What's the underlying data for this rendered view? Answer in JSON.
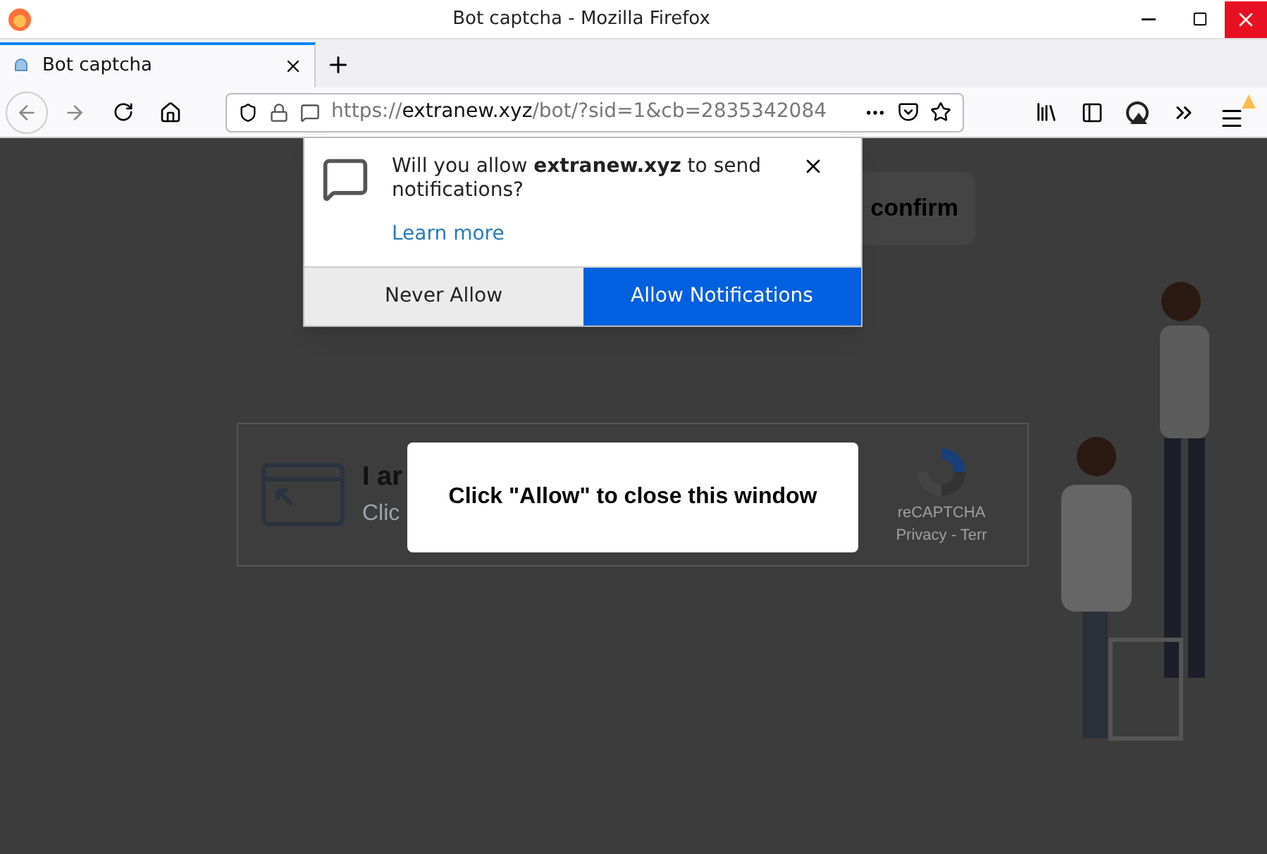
{
  "window": {
    "title": "Bot captcha - Mozilla Firefox"
  },
  "tabs": [
    {
      "label": "Bot captcha",
      "selected": true
    }
  ],
  "address_bar": {
    "url_prefix": "https://",
    "url_domain": "extranew.xyz",
    "url_rest": "/bot/?sid=1&cb=2835342084"
  },
  "notification_popup": {
    "message": "Will you allow **extranew.xyz** to send notifications?",
    "link": "Learn more",
    "buttons": [
      {
        "label": "Never Allow",
        "kind": "secondary"
      },
      {
        "label": "Allow Notifications",
        "kind": "primary"
      }
    ]
  },
  "page": {
    "confirm_text": "confirm",
    "captcha_title": "I ar",
    "captcha_subtitle": "Clic",
    "recaptcha_label": "reCAPTCHA",
    "recaptcha_links": "Privacy - Terr"
  },
  "dialog": {
    "message": "Click \"Allow\" to close this window"
  }
}
